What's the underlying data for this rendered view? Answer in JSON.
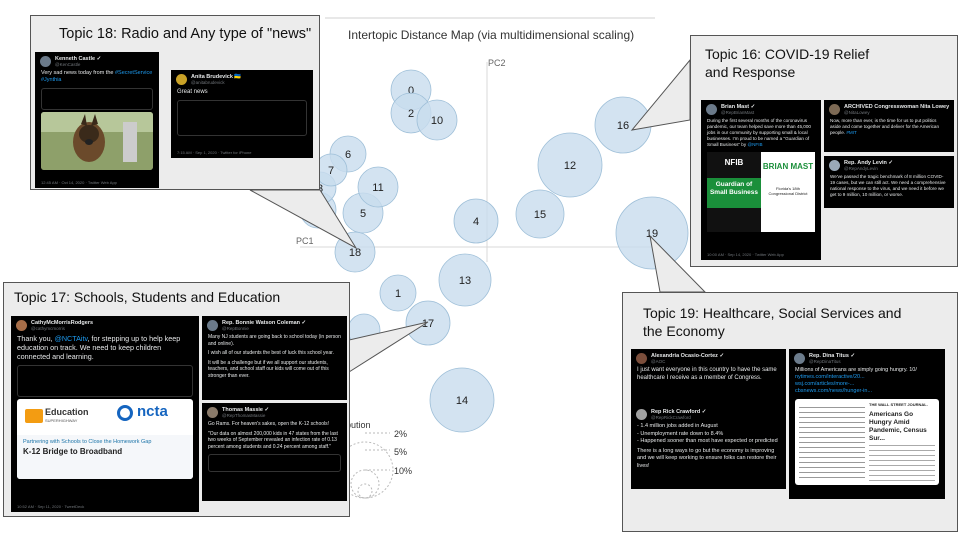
{
  "map": {
    "title": "Intertopic Distance Map (via multidimensional scaling)",
    "pc1": "PC1",
    "pc2": "PC2",
    "topics": [
      "0",
      "1",
      "2",
      "3",
      "4",
      "5",
      "6",
      "7",
      "10",
      "11",
      "12",
      "13",
      "14",
      "15",
      "16",
      "17",
      "18",
      "19"
    ]
  },
  "legend": {
    "label": "ic distribution",
    "values": [
      "2%",
      "5%",
      "10%"
    ]
  },
  "colors": {
    "bubble_fill": "#c8dced",
    "bubble_stroke": "#9ebfd8",
    "callout_bg": "#ececec"
  },
  "callouts": {
    "t18": {
      "title": "Topic 18: Radio and Any type of \"news\"",
      "tweet1": {
        "text": "Very sad news today from the ",
        "link": "#SecretService",
        "hashtag": "#Jynthia"
      },
      "tweet2": {
        "text": "Great news"
      }
    },
    "t16": {
      "title_l1": "Topic 16: COVID-19 Relief",
      "title_l2": "and Response",
      "tweet1": {
        "text": "During the first several months of the coronavirus pandemic, our team helped save more than 45,000 jobs in our community by supporting small & local businesses. I'm proud to be named a \"Guardian of Small Business\" by",
        "link": "@NFIB"
      },
      "nfib": "NFIB",
      "guardian": "Guardian of Small Business",
      "brian": "BRIAN MAST",
      "district": "Florida's 18th Congressional District",
      "tweet2": {
        "text": "Now, more than ever, is the time for us to put politics aside and come together and deliver for the American people. ",
        "link": "#MIT"
      },
      "tweet3": {
        "text": "We've passed the tragic benchmark of 8 million COVID-19 cases, but we can still act. We need a comprehensive national response to the virus, and we need it before we get to 9 million, 10 million, or worse."
      }
    },
    "t17": {
      "title": "Topic 17: Schools, Students and Education",
      "tweet1": {
        "name": "CathyMcMorrisRodgers",
        "text": "Thank you, ",
        "link": "@NCTAitv",
        "text2": ", for stepping up to help keep education on track. We need to keep children connected and learning."
      },
      "edu": "Education",
      "edu_sub": "SUPERHIGHWAY",
      "ncta": "ncta",
      "card_line1": "Partnering with Schools to Close the Homework Gap",
      "card_line2": "K-12 Bridge to Broadband",
      "footer": "10:52 AM · Sep 11, 2020 · TweetDeck",
      "tweet2": {
        "text": "Many NJ students are going back to school today (in person and online).",
        "text2": "I wish all of our students the best of luck this school year.",
        "text3": "It will be a challenge but if we all support our students, teachers, and school staff our kids will come out of this stronger than ever."
      },
      "tweet3": {
        "text": "Go Rams. For heaven's sakes, open the K-12 schools!",
        "text2": "\"Our data on almost 200,000 kids in 47 states from the last two weeks of September revealed an infection rate of 0.13 percent among students and 0.24 percent among staff.\""
      }
    },
    "t19": {
      "title_l1": "Topic 19: Healthcare, Social Services and",
      "title_l2": "the Economy",
      "tweet1": {
        "text": "I just want everyone in this country to have the same healthcare I receive as a member of Congress."
      },
      "tweet2": {
        "l1": "- 1.4 million jobs added in August",
        "l2": "- Unemployment rate down to 8.4%",
        "l3": "- Happened sooner than most have expected or predicted",
        "l4": "There is a long ways to go but the economy is improving and we will keep working to ensure folks can restore their lives!"
      },
      "tweet3": {
        "text": "Millions of Americans are simply going hungry. 10/",
        "link": "nytimes.com/interactive/20...",
        "link2": "wsj.com/articles/more-...",
        "link3": "cbsnews.com/news/hunger-in..."
      },
      "wsj": "THE WALL STREET JOURNAL.",
      "wsj_head": "Americans Go Hungry Amid Pandemic, Census Sur..."
    }
  }
}
